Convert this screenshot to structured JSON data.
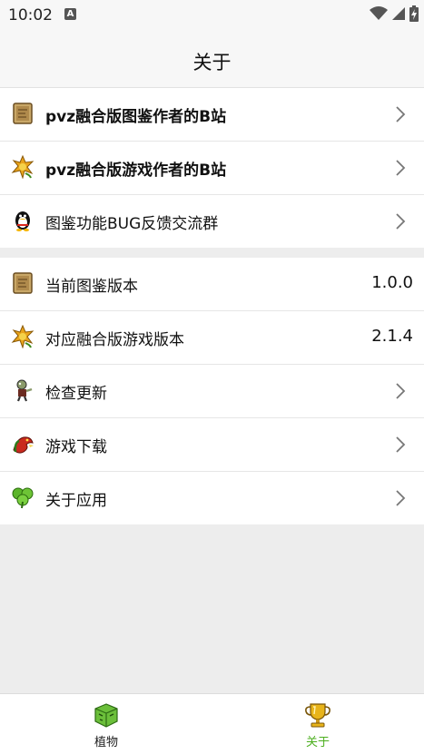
{
  "status_bar": {
    "time": "10:02",
    "notification_badge": "A"
  },
  "app_bar": {
    "title": "关于"
  },
  "links": [
    {
      "label": "pvz融合版图鉴作者的B站",
      "icon": "book-icon"
    },
    {
      "label": "pvz融合版游戏作者的B站",
      "icon": "fire-flower-icon"
    },
    {
      "label": "图鉴功能BUG反馈交流群",
      "icon": "qq-penguin-icon"
    }
  ],
  "info": [
    {
      "label": "当前图鉴版本",
      "value": "1.0.0",
      "icon": "book-icon"
    },
    {
      "label": "对应融合版游戏版本",
      "value": "2.1.4",
      "icon": "fire-flower-icon"
    },
    {
      "label": "检查更新",
      "icon": "zombie-icon"
    },
    {
      "label": "游戏下载",
      "icon": "dragon-icon"
    },
    {
      "label": "关于应用",
      "icon": "clover-icon"
    }
  ],
  "bottom_nav": {
    "plants_label": "植物",
    "about_label": "关于",
    "active_color": "#4caf1f",
    "inactive_color": "#222222"
  }
}
